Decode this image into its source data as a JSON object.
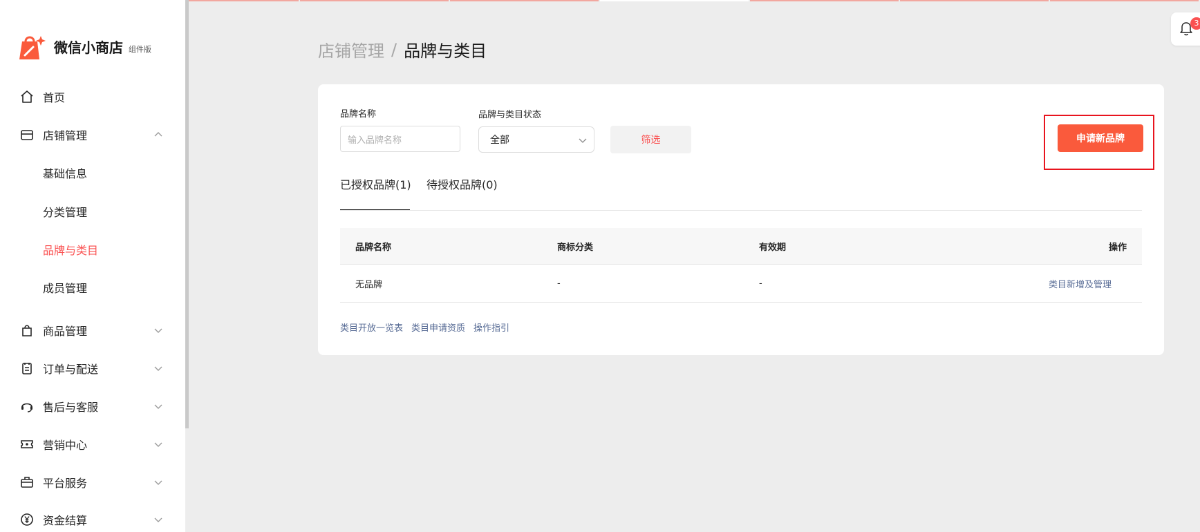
{
  "app": {
    "name": "微信小商店",
    "edition": "组件版"
  },
  "sidebar": {
    "items": [
      {
        "label": "首页",
        "icon": "home-icon"
      },
      {
        "label": "店铺管理",
        "icon": "shop-icon",
        "expanded": true,
        "children": [
          {
            "label": "基础信息"
          },
          {
            "label": "分类管理"
          },
          {
            "label": "品牌与类目",
            "active": true
          },
          {
            "label": "成员管理"
          }
        ]
      },
      {
        "label": "商品管理",
        "icon": "shopping-bag-icon"
      },
      {
        "label": "订单与配送",
        "icon": "clipboard-icon"
      },
      {
        "label": "售后与客服",
        "icon": "headset-icon"
      },
      {
        "label": "营销中心",
        "icon": "ticket-icon"
      },
      {
        "label": "平台服务",
        "icon": "briefcase-icon"
      },
      {
        "label": "资金结算",
        "icon": "yen-icon"
      }
    ]
  },
  "notifications": {
    "count": "3"
  },
  "breadcrumb": {
    "parent": "店铺管理",
    "separator": "/",
    "current": "品牌与类目"
  },
  "filters": {
    "brand_name_label": "品牌名称",
    "brand_name_placeholder": "输入品牌名称",
    "status_label": "品牌与类目状态",
    "status_value": "全部",
    "filter_button": "筛选",
    "apply_button": "申请新品牌"
  },
  "tabs": [
    {
      "label": "已授权品牌(1)",
      "active": true
    },
    {
      "label": "待授权品牌(0)"
    }
  ],
  "table": {
    "columns": [
      "品牌名称",
      "商标分类",
      "有效期",
      "操作"
    ],
    "rows": [
      {
        "brand": "无品牌",
        "trademark": "-",
        "validity": "-",
        "action": "类目新增及管理"
      }
    ]
  },
  "footer_links": [
    "类目开放一览表",
    "类目申请资质",
    "操作指引"
  ],
  "colors": {
    "accent": "#fa5151",
    "primary_button": "#fa5a3c",
    "link": "#576b95",
    "highlight_border": "#e8141e"
  }
}
